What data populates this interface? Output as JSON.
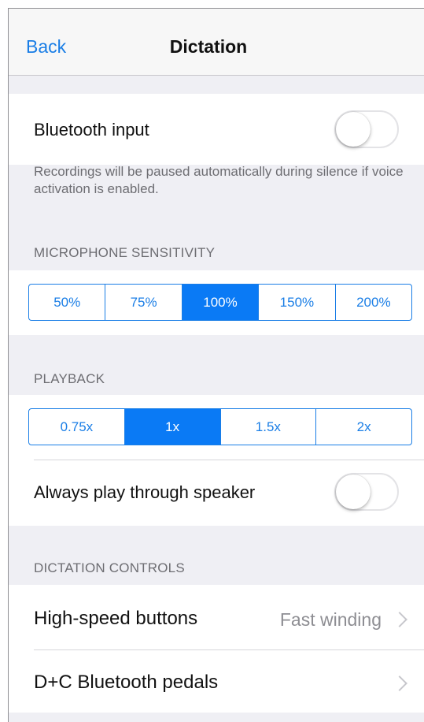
{
  "nav": {
    "back_label": "Back",
    "title": "Dictation"
  },
  "bluetooth_input": {
    "label": "Bluetooth input",
    "enabled": false
  },
  "voice_activation_note": "Recordings will be paused automatically during silence if voice activation is enabled.",
  "microphone_sensitivity": {
    "header": "MICROPHONE SENSITIVITY",
    "options": [
      "50%",
      "75%",
      "100%",
      "150%",
      "200%"
    ],
    "selected": "100%"
  },
  "playback": {
    "header": "PLAYBACK",
    "options": [
      "0.75x",
      "1x",
      "1.5x",
      "2x"
    ],
    "selected": "1x",
    "speaker_label": "Always play through speaker",
    "speaker_enabled": false
  },
  "dictation_controls": {
    "header": "DICTATION CONTROLS",
    "high_speed_label": "High-speed buttons",
    "high_speed_value": "Fast winding",
    "pedals_label": "D+C Bluetooth pedals"
  },
  "colors": {
    "accent": "#0a7af5",
    "background": "#efeff4"
  }
}
